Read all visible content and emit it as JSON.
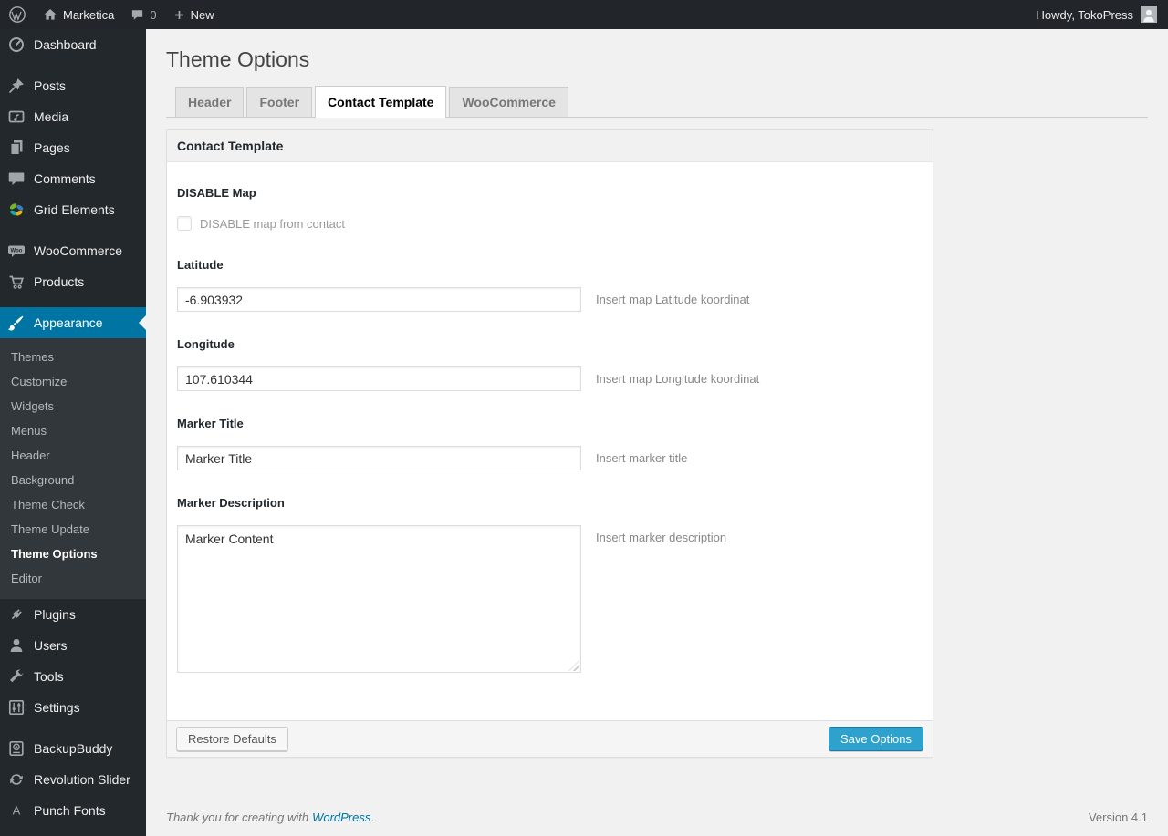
{
  "colors": {
    "admin_bar_bg": "#22262a",
    "sidebar_bg": "#23282d",
    "submenu_bg": "#32373c",
    "accent_blue": "#0074a2",
    "primary_button_blue": "#2ea2cc",
    "page_bg": "#f1f1f1"
  },
  "admin_bar": {
    "site_name": "Marketica",
    "comment_count": "0",
    "new_label": "New",
    "howdy": "Howdy, TokoPress"
  },
  "sidebar": {
    "items": [
      {
        "label": "Dashboard",
        "icon": "dashboard-icon"
      },
      {
        "label": "Posts",
        "icon": "pushpin-icon"
      },
      {
        "label": "Media",
        "icon": "media-icon"
      },
      {
        "label": "Pages",
        "icon": "pages-icon"
      },
      {
        "label": "Comments",
        "icon": "comments-icon"
      },
      {
        "label": "Grid Elements",
        "icon": "grid-elements-icon"
      },
      {
        "label": "WooCommerce",
        "icon": "woocommerce-icon"
      },
      {
        "label": "Products",
        "icon": "cart-icon"
      },
      {
        "label": "Appearance",
        "icon": "brush-icon",
        "active": true
      },
      {
        "label": "Plugins",
        "icon": "plug-icon"
      },
      {
        "label": "Users",
        "icon": "user-icon"
      },
      {
        "label": "Tools",
        "icon": "wrench-icon"
      },
      {
        "label": "Settings",
        "icon": "sliders-icon"
      },
      {
        "label": "BackupBuddy",
        "icon": "backup-icon"
      },
      {
        "label": "Revolution Slider",
        "icon": "cycle-icon"
      },
      {
        "label": "Punch Fonts",
        "icon": "letter-a-icon"
      }
    ],
    "appearance_submenu": [
      "Themes",
      "Customize",
      "Widgets",
      "Menus",
      "Header",
      "Background",
      "Theme Check",
      "Theme Update",
      "Theme Options",
      "Editor"
    ],
    "current_submenu_item": "Theme Options"
  },
  "page": {
    "title": "Theme Options",
    "tabs": [
      {
        "label": "Header",
        "active": false
      },
      {
        "label": "Footer",
        "active": false
      },
      {
        "label": "Contact Template",
        "active": true
      },
      {
        "label": "WooCommerce",
        "active": false
      }
    ],
    "panel": {
      "title": "Contact Template",
      "fields": {
        "disable_map": {
          "label": "DISABLE Map",
          "checkbox_label": "DISABLE map from contact",
          "checked": false
        },
        "latitude": {
          "label": "Latitude",
          "value": "-6.903932",
          "hint": "Insert map Latitude koordinat"
        },
        "longitude": {
          "label": "Longitude",
          "value": "107.610344",
          "hint": "Insert map Longitude koordinat"
        },
        "marker_title": {
          "label": "Marker Title",
          "value": "Marker Title",
          "hint": "Insert marker title"
        },
        "marker_description": {
          "label": "Marker Description",
          "value": "Marker Content",
          "hint": "Insert marker description"
        }
      },
      "buttons": {
        "restore": "Restore Defaults",
        "save": "Save Options"
      }
    },
    "footer": {
      "thanks_prefix": "Thank you for creating with",
      "wordpress_link": "WordPress",
      "suffix": ".",
      "version": "Version 4.1"
    }
  }
}
